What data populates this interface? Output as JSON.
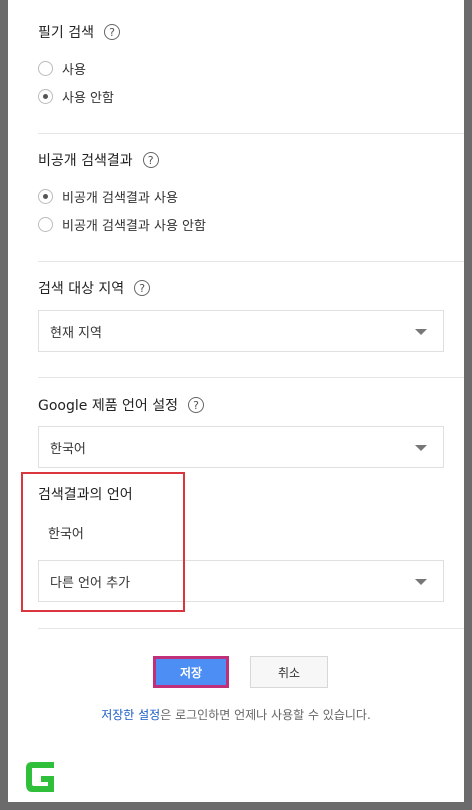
{
  "handwriting_search": {
    "title": "필기 검색",
    "options": [
      {
        "label": "사용",
        "checked": false
      },
      {
        "label": "사용 안함",
        "checked": true
      }
    ]
  },
  "private_results": {
    "title": "비공개 검색결과",
    "options": [
      {
        "label": "비공개 검색결과 사용",
        "checked": true
      },
      {
        "label": "비공개 검색결과 사용 안함",
        "checked": false
      }
    ]
  },
  "region": {
    "title": "검색 대상 지역",
    "selected": "현재 지역"
  },
  "product_language": {
    "title": "Google 제품 언어 설정",
    "selected": "한국어"
  },
  "results_language": {
    "title": "검색결과의 언어",
    "current": "한국어",
    "add_placeholder": "다른 언어 추가"
  },
  "actions": {
    "save_label": "저장",
    "cancel_label": "취소"
  },
  "footnote": {
    "link_text": "저장한 설정",
    "rest_text": "은 로그인하면 언제나 사용할 수 있습니다."
  },
  "help_glyph": "?",
  "logo": {
    "letter": "G",
    "color": "#2fbf3a"
  },
  "colors": {
    "accent": "#4d8ef5",
    "highlight": "#d9363e",
    "link": "#1a5cc8"
  }
}
